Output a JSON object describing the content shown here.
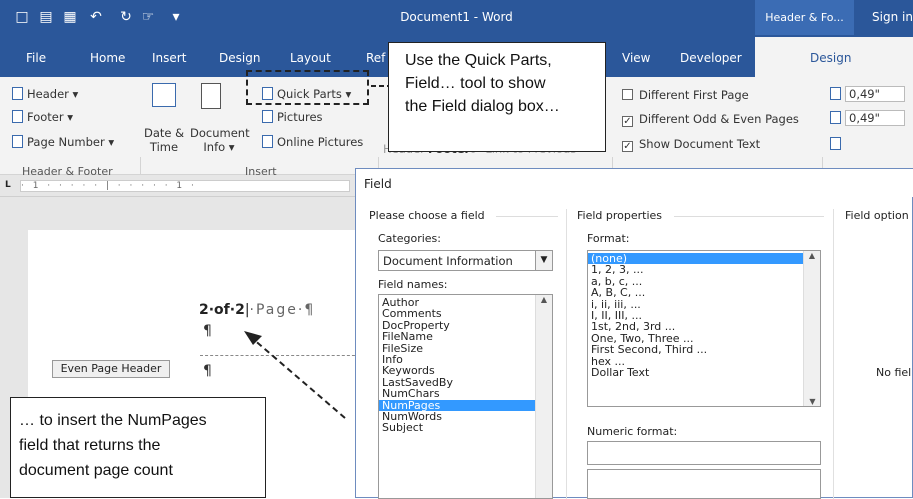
{
  "titlebar": {
    "title": "Document1 - Word",
    "context_tab": "Header & Fo...",
    "sign_in": "Sign in"
  },
  "tabs": [
    "File",
    "Home",
    "Insert",
    "Design",
    "Layout",
    "Ref",
    "View",
    "Developer",
    "Design"
  ],
  "ribbon": {
    "header": "Header",
    "footer": "Footer",
    "page_number": "Page Number",
    "group_header_footer": "Header & Footer",
    "date_time_line1": "Date &",
    "date_time_line2": "Time",
    "document_info_line1": "Document",
    "document_info_line2": "Info",
    "quick_parts": "Quick Parts",
    "pictures": "Pictures",
    "online_pictures": "Online Pictures",
    "group_insert": "Insert",
    "nav_header": "Header",
    "nav_footer": "Footer",
    "link_previous": "Link to Previous",
    "different_first_page": "Different First Page",
    "different_odd_even": "Different Odd & Even Pages",
    "show_document_text": "Show Document Text",
    "header_pos": "0,49\"",
    "footer_pos": "0,49\""
  },
  "ruler": {
    "marks": "· 1 · · · · · | · · · · · 1 ·"
  },
  "document": {
    "page_field": "2·of·2",
    "page_word": "·Page·¶",
    "pilcrow": "¶",
    "even_page_header": "Even Page Header"
  },
  "dialog": {
    "title": "Field",
    "choose_label": "Please choose a field",
    "categories_label": "Categories:",
    "category_value": "Document Information",
    "field_names_label": "Field names:",
    "field_names": [
      "Author",
      "Comments",
      "DocProperty",
      "FileName",
      "FileSize",
      "Info",
      "Keywords",
      "LastSavedBy",
      "NumChars",
      "NumPages",
      "NumWords",
      "Subject"
    ],
    "selected_field": "NumPages",
    "field_properties_label": "Field properties",
    "format_label": "Format:",
    "formats": [
      "(none)",
      "1, 2, 3, ...",
      "a, b, c, ...",
      "A, B, C, ...",
      "i, ii, iii, ...",
      "I, II, III, ...",
      "1st, 2nd, 3rd ...",
      "One, Two, Three ...",
      "First Second, Third ...",
      "hex ...",
      "Dollar Text"
    ],
    "selected_format": "(none)",
    "numeric_format_label": "Numeric format:",
    "field_options_label": "Field option",
    "no_field_text": "No fiel"
  },
  "callouts": {
    "quick_parts": [
      "Use the Quick Parts,",
      "Field… tool to show",
      "the Field dialog box…"
    ],
    "numpages": [
      "… to insert the NumPages",
      "field that returns the",
      "document page count"
    ]
  }
}
